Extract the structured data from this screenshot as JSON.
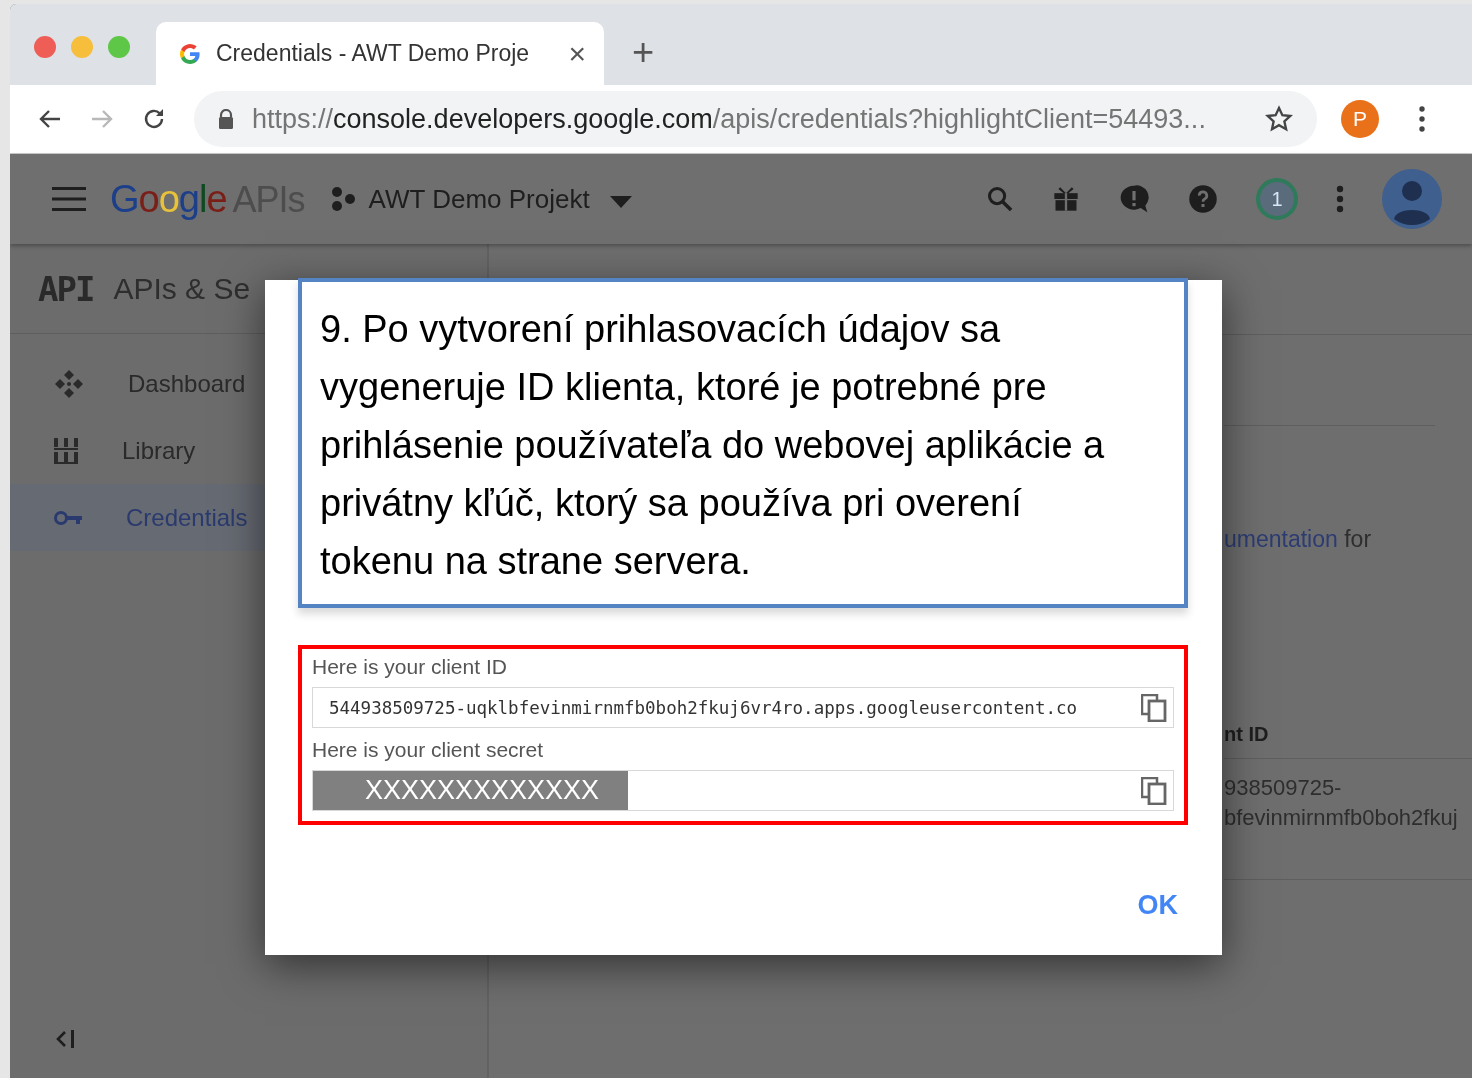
{
  "browser": {
    "tab": {
      "title": "Credentials - AWT Demo Proje",
      "close": "×"
    },
    "new_tab": "+",
    "url": {
      "scheme": "https://",
      "host": "console.developers.google.com",
      "path": "/apis/credentials?highlightClient=54493..."
    },
    "profile": "P"
  },
  "header": {
    "logo": "Google",
    "logo_suffix": "APIs",
    "project": "AWT Demo Projekt",
    "notifications": "1"
  },
  "sidebar": {
    "badge": "API",
    "title": "APIs & Se",
    "items": [
      {
        "label": "Dashboard",
        "selected": false
      },
      {
        "label": "Library",
        "selected": false
      },
      {
        "label": "Credentials",
        "selected": true
      }
    ]
  },
  "main": {
    "doc_link": "umentation",
    "doc_after": " for",
    "column_header": "nt ID",
    "id_lines": [
      "938509725-",
      "bfevinmirnmfb0boh2fkuj"
    ]
  },
  "dialog": {
    "annotation": "9.  Po vytvorení prihlasovacích údajov sa vygeneruje ID klienta, ktoré je potrebné pre prihlásenie používateľa do webovej aplikácie a privátny kľúč, ktorý sa používa pri overení tokenu na strane servera.",
    "fields": [
      {
        "label": "Here is your client ID",
        "value": "544938509725-uqklbfevinmirnmfb0boh2fkuj6vr4ro.apps.googleusercontent.co",
        "redacted": false
      },
      {
        "label": "Here is your client secret",
        "value": "XXXXXXXXXXXXX",
        "redacted": true
      }
    ],
    "ok": "OK"
  }
}
